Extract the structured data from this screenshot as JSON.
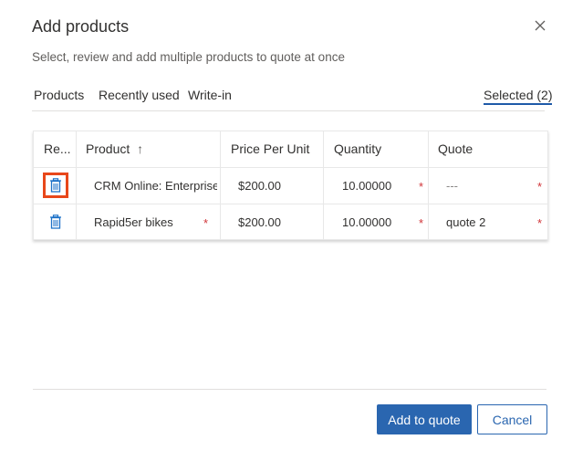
{
  "dialog": {
    "title": "Add products",
    "subtitle": "Select, review and add multiple products to quote at once"
  },
  "tabs": [
    {
      "label": "Products"
    },
    {
      "label": "Recently used"
    },
    {
      "label": "Write-in"
    },
    {
      "label": "Selected (2)"
    }
  ],
  "grid": {
    "columns": [
      "Re...",
      "Product",
      "Price Per Unit",
      "Quantity",
      "Quote"
    ],
    "sort_indicator": "↑",
    "rows": [
      {
        "product": "CRM Online: Enterprise",
        "price": "$200.00",
        "quantity": "10.00000",
        "quote": "---"
      },
      {
        "product": "Rapid5er bikes",
        "price": "$200.00",
        "quantity": "10.00000",
        "quote": "quote 2"
      }
    ],
    "required_marker": "*"
  },
  "footer": {
    "add_label": "Add to quote",
    "cancel_label": "Cancel"
  },
  "colors": {
    "accent": "#2a66b0",
    "required": "#d13438",
    "highlight": "#e8471a"
  },
  "icons": {
    "close": "close-icon",
    "delete": "trash-icon",
    "sort": "sort-ascending-icon"
  }
}
